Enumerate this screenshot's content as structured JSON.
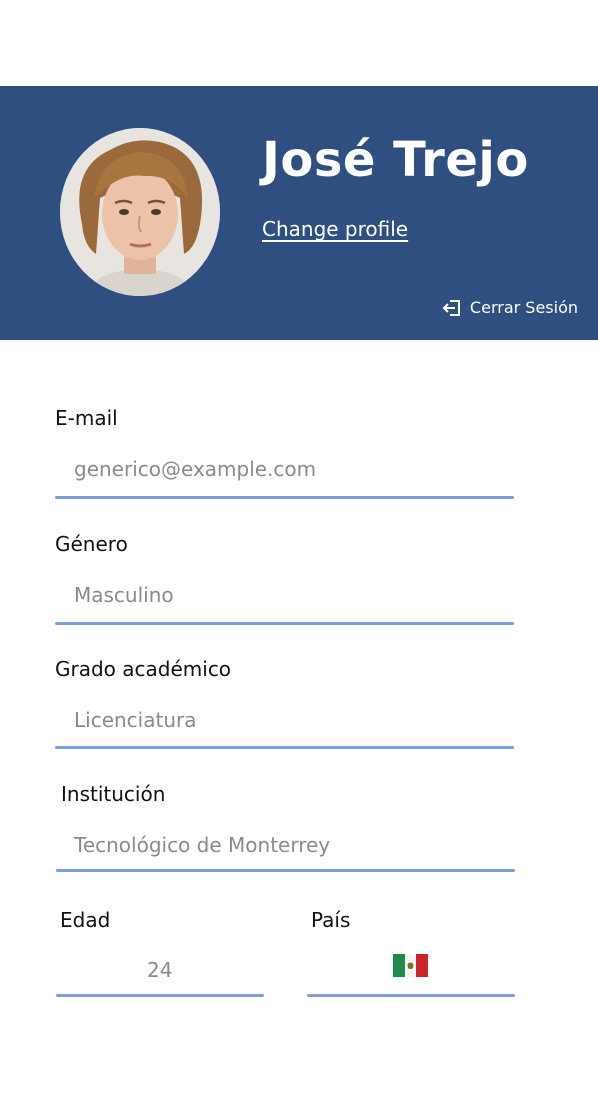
{
  "header": {
    "name": "José Trejo",
    "change_profile_label": "Change profile",
    "logout_label": "Cerrar Sesión"
  },
  "form": {
    "email": {
      "label": "E-mail",
      "value": "generico@example.com"
    },
    "gender": {
      "label": "Género",
      "value": "Masculino"
    },
    "degree": {
      "label": "Grado académico",
      "value": "Licenciatura"
    },
    "institution": {
      "label": "Institución",
      "value": "Tecnológico de Monterrey"
    },
    "age": {
      "label": "Edad",
      "value": "24"
    },
    "country": {
      "label": "País",
      "flag_icon": "mexico-flag-icon"
    }
  },
  "colors": {
    "header_bg": "#2e4f7f",
    "underline": "#7b9de0",
    "value_text": "#8a8a8a"
  }
}
